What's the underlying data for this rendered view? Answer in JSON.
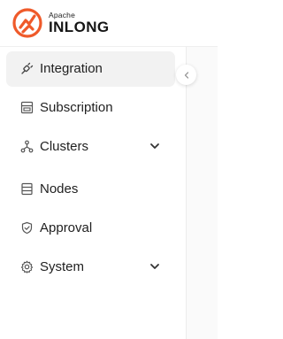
{
  "brand": {
    "top_text": "Apache",
    "name": "INLONG",
    "logo_icon": "inlong-logo"
  },
  "colors": {
    "brand_orange": "#ef5a2a",
    "active_bg": "#f2f2f2",
    "text": "#1f1f1f",
    "icon": "#555555"
  },
  "sidebar": {
    "items": [
      {
        "label": "Integration",
        "icon": "plug-icon",
        "active": true,
        "has_submenu": false
      },
      {
        "label": "Subscription",
        "icon": "subscription-icon",
        "active": false,
        "has_submenu": false
      },
      {
        "label": "Clusters",
        "icon": "cluster-icon",
        "active": false,
        "has_submenu": true
      },
      {
        "label": "Nodes",
        "icon": "nodes-icon",
        "active": false,
        "has_submenu": false
      },
      {
        "label": "Approval",
        "icon": "shield-check-icon",
        "active": false,
        "has_submenu": false
      },
      {
        "label": "System",
        "icon": "gear-icon",
        "active": false,
        "has_submenu": true
      }
    ],
    "collapse_icon": "chevron-left-icon"
  }
}
